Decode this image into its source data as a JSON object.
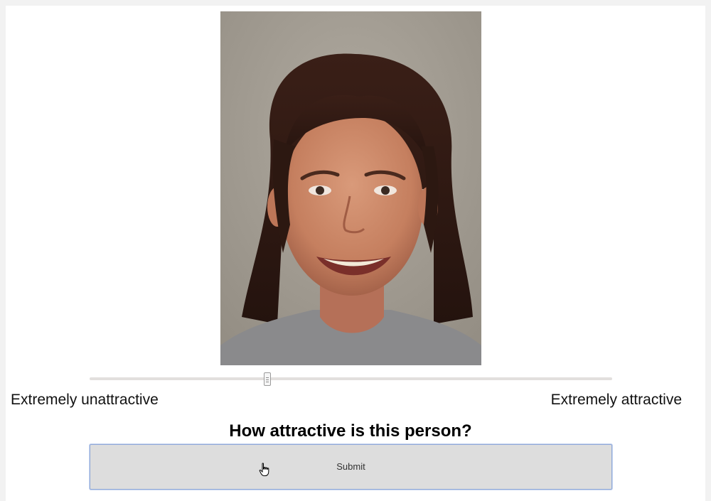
{
  "photo": {
    "alt": "Portrait photograph of a smiling woman"
  },
  "slider": {
    "value": 0.34,
    "min_label": "Extremely unattractive",
    "max_label": "Extremely attractive"
  },
  "question": "How attractive is this person?",
  "submit": {
    "label": "Submit"
  },
  "cursor": {
    "icon": "hand-pointer-icon"
  },
  "colors": {
    "page_bg": "#f2f2f2",
    "track": "#e2dfdd",
    "button_bg": "#dddddd",
    "button_border": "#8fa8d8"
  }
}
